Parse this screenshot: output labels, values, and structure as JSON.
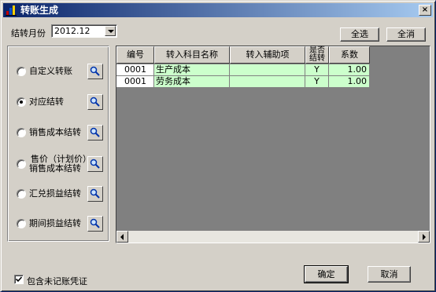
{
  "window": {
    "title": "转账生成",
    "close_glyph": "×",
    "title_icon": "chart-bar-icon"
  },
  "toolbar": {
    "month_label": "结转月份",
    "month_value": "2012.12",
    "select_all_label": "全选",
    "clear_all_label": "全消"
  },
  "transfer_types": [
    {
      "label": "自定义转账",
      "checked": false
    },
    {
      "label": "对应结转",
      "checked": true
    },
    {
      "label": "销售成本结转",
      "checked": false
    },
    {
      "label_line1": "售价（计划价）",
      "label_line2": "销售成本结转",
      "checked": false
    },
    {
      "label": "汇兑损益结转",
      "checked": false
    },
    {
      "label": "期间损益结转",
      "checked": false
    }
  ],
  "table": {
    "columns": [
      "编号",
      "转入科目名称",
      "转入辅助项",
      "是否结转",
      "系数"
    ],
    "column_header_lines": {
      "is_transfer_1": "是否",
      "is_transfer_2": "结转"
    },
    "rows": [
      {
        "id": "0001",
        "account": "生产成本",
        "aux": "",
        "transfer": "Y",
        "coef": "1.00"
      },
      {
        "id": "0001",
        "account": "劳务成本",
        "aux": "",
        "transfer": "Y",
        "coef": "1.00"
      }
    ],
    "row_color": "#ccffcc"
  },
  "footer": {
    "include_unposted_label": "包含未记账凭证",
    "include_unposted_checked": true,
    "ok_label": "确定",
    "cancel_label": "取消"
  },
  "colors": {
    "title_gradient_start": "#0a246a",
    "title_gradient_end": "#a6caf0",
    "dialog_bg": "#d4d0c8"
  }
}
